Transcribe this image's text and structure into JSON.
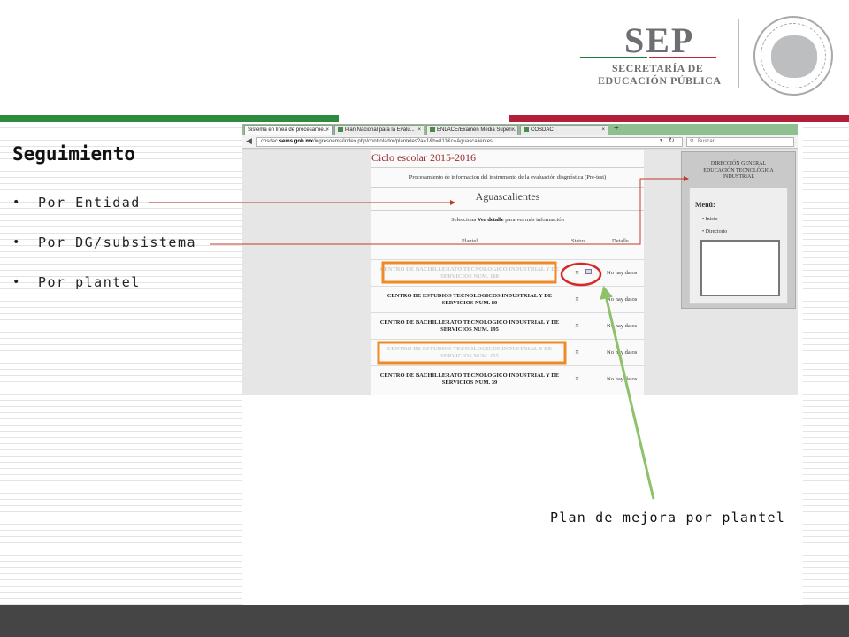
{
  "header": {
    "logo_text": "SEP",
    "subtitle_line1": "SECRETARÍA DE",
    "subtitle_line2": "EDUCACIÓN PÚBLICA",
    "seal_icon": "mexico-coat-of-arms-seal-icon",
    "colors": {
      "green": "#2e8b3e",
      "red": "#b11f39",
      "gray": "#6d6e71"
    }
  },
  "slide": {
    "title": "Seguimiento",
    "bullets": [
      {
        "label": "Por Entidad"
      },
      {
        "label": "Por DG/subsistema"
      },
      {
        "label": "Por plantel"
      }
    ],
    "bullet_char": "•",
    "caption": "Plan de mejora por plantel"
  },
  "browser": {
    "tabs": [
      {
        "label": "Sistema en línea de procesamie...",
        "active": true
      },
      {
        "label": "Plan Nacional para la Evalu...",
        "active": false
      },
      {
        "label": "ENLACE/Examen Media Superi...",
        "active": false
      },
      {
        "label": "COSDAC",
        "active": false
      }
    ],
    "tab_close": "×",
    "new_tab": "+",
    "url_prefix": "cosdac.",
    "url_domain": "sems.gob.mx",
    "url_rest": "/ingresoems/index.php/controlador/planteles?a=1&b=811&c=Aguascalientes",
    "search_placeholder": "Buscar"
  },
  "page": {
    "ciclo": "Ciclo escolar 2015-2016",
    "procesamiento": "Procesamiento de informacion del instrumento de la evaluación diagnóstica (Pre-test)",
    "estado": "Aguascalientes",
    "selecciona_pre": "Selecciona ",
    "selecciona_bold": "Ver detalle",
    "selecciona_post": " para ver más información",
    "columns": {
      "plantel": "Plantel",
      "status": "Status",
      "detalle": "Detalle"
    },
    "rows": [
      {
        "name": "CENTRO DE BACHILLERATO TECNOLOGICO INDUSTRIAL Y DE SERVICIOS NUM. 168",
        "status": "×",
        "detail": "No hay datos",
        "highlighted": true
      },
      {
        "name": "CENTRO DE ESTUDIOS TECNOLOGICOS INDUSTRIAL Y DE SERVICIOS NUM. 80",
        "status": "×",
        "detail": "No hay datos",
        "highlighted": false
      },
      {
        "name": "CENTRO DE BACHILLERATO TECNOLOGICO INDUSTRIAL Y DE SERVICIOS NUM. 195",
        "status": "×",
        "detail": "No hay datos",
        "highlighted": false
      },
      {
        "name": "CENTRO DE ESTUDIOS TECNOLOGICOS INDUSTRIAL Y DE SERVICIOS NUM. 155",
        "status": "×",
        "detail": "No hay datos",
        "highlighted": true
      },
      {
        "name": "CENTRO DE BACHILLERATO TECNOLOGICO INDUSTRIAL Y DE SERVICIOS NUM. 39",
        "status": "×",
        "detail": "No hay datos",
        "highlighted": false
      }
    ],
    "sidebar": {
      "line1": "DIRECCIÓN GENERAL",
      "line2": "EDUCACIÓN TECNOLÓGICA",
      "line3": "INDUSTRIAL",
      "menu_title": "Menú:",
      "menu_items": [
        {
          "label": "Inicio"
        },
        {
          "label": "Directorio"
        }
      ],
      "item_bullet": "•"
    }
  },
  "annotations": {
    "highlight_color": "#f08a24",
    "circle_color": "#d62a2a",
    "connector_color": "#c0392b",
    "arrow_color": "#8dc26b"
  }
}
